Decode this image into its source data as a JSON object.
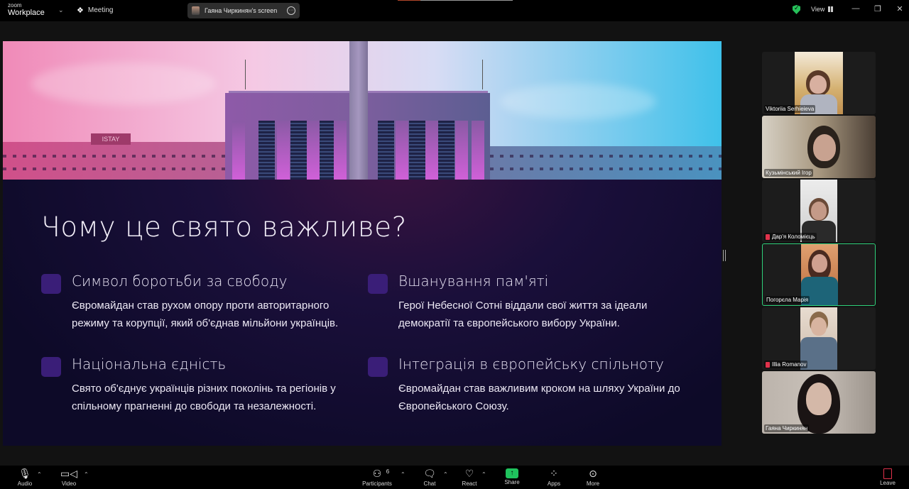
{
  "titlebar": {
    "logo_top": "zoom",
    "logo_bottom": "Workplace",
    "meeting_label": "Meeting",
    "share_pill_label": "Гаяна Чиркинян's screen",
    "view_label": "View",
    "window_controls": [
      "minimize-icon",
      "restore-icon",
      "close-icon"
    ],
    "security_color": "#26c05a"
  },
  "slide": {
    "title": "Чому це свято важливе?",
    "banner_sign": "ISTAY",
    "points": [
      {
        "heading": "Символ боротьби за свободу",
        "body": "Євромайдан став рухом опору проти авторитарного режиму та корупції, який об'єднав мільйони українців."
      },
      {
        "heading": "Вшанування пам'яті",
        "body": "Герої Небесної Сотні віддали свої життя за ідеали демократії та європейського вибору України."
      },
      {
        "heading": "Національна єдність",
        "body": "Свято об'єднує українців різних поколінь та регіонів у спільному прагненні до свободи та незалежності."
      },
      {
        "heading": "Інтеграція в європейську спільноту",
        "body": "Євромайдан став важливим кроком на шляху України до Європейського Союзу."
      }
    ],
    "accent_color": "#3a1e78"
  },
  "gallery": {
    "participants": [
      {
        "name": "Viktoriia Serhieieva",
        "muted": false,
        "active": false
      },
      {
        "name": "Кузьмінський Ігор",
        "muted": false,
        "active": false
      },
      {
        "name": "Дар'я Коломієць",
        "muted": true,
        "active": false
      },
      {
        "name": "Погорєла Марія",
        "muted": false,
        "active": true
      },
      {
        "name": "Illia Romanov",
        "muted": true,
        "active": false
      },
      {
        "name": "Гаяна Чиркинян",
        "muted": false,
        "active": false
      }
    ],
    "active_speaker_color": "#2fd07a"
  },
  "toolbar": {
    "audio": "Audio",
    "video": "Video",
    "participants": "Participants",
    "participants_count": "6",
    "chat": "Chat",
    "react": "React",
    "share": "Share",
    "apps": "Apps",
    "more": "More",
    "leave": "Leave",
    "share_color": "#1fc35d",
    "leave_color": "#e0324b"
  }
}
